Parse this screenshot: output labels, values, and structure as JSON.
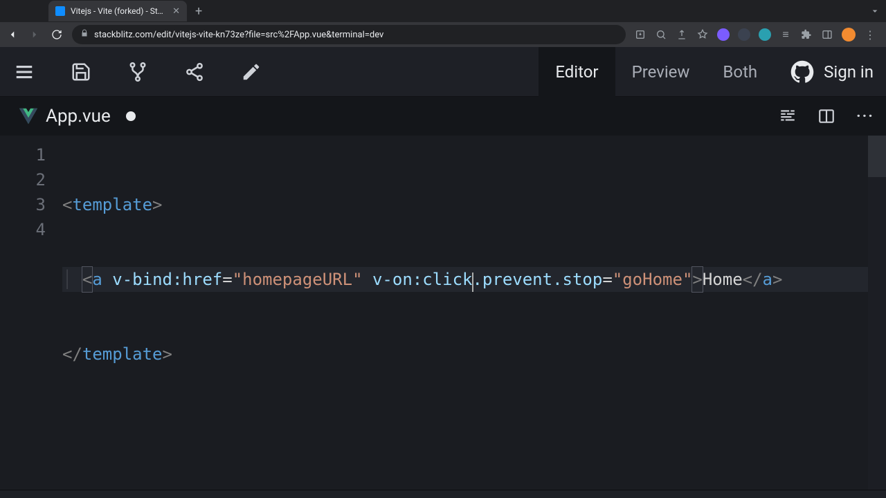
{
  "browser": {
    "tab_title": "Vitejs - Vite (forked) - StackBl…",
    "url": "stackblitz.com/edit/vitejs-vite-kn73ze?file=src%2FApp.vue&terminal=dev"
  },
  "toolbar": {
    "views": {
      "editor": "Editor",
      "preview": "Preview",
      "both": "Both"
    },
    "signin": "Sign in"
  },
  "file": {
    "name": "App.vue",
    "dirty": true
  },
  "code": {
    "lines": [
      "1",
      "2",
      "3",
      "4"
    ],
    "l1": {
      "open": "<",
      "tag": "template",
      "close": ">"
    },
    "l2": {
      "indent": "  ",
      "lt": "<",
      "tag": "a",
      "sp1": " ",
      "attr1a": "v-bind",
      "attr1b": ":href",
      "eq1": "=",
      "str1q1": "\"",
      "str1": "homepageURL",
      "str1q2": "\"",
      "sp2": " ",
      "attr2a": "v-on",
      "attr2b": ":click",
      "attr2c": ".prevent.stop",
      "eq2": "=",
      "str2q1": "\"",
      "str2": "goHome",
      "str2q2": "\"",
      "gt": ">",
      "text": "Home",
      "lt2": "</",
      "tag2": "a",
      "gt2": ">"
    },
    "l3": {
      "open": "</",
      "tag": "template",
      "close": ">"
    }
  },
  "colors": {
    "bg": "#1a1c21",
    "toolbar_bg": "#1e2026",
    "tag": "#569cd6",
    "attr": "#9cdcfe",
    "string": "#ce9178"
  }
}
